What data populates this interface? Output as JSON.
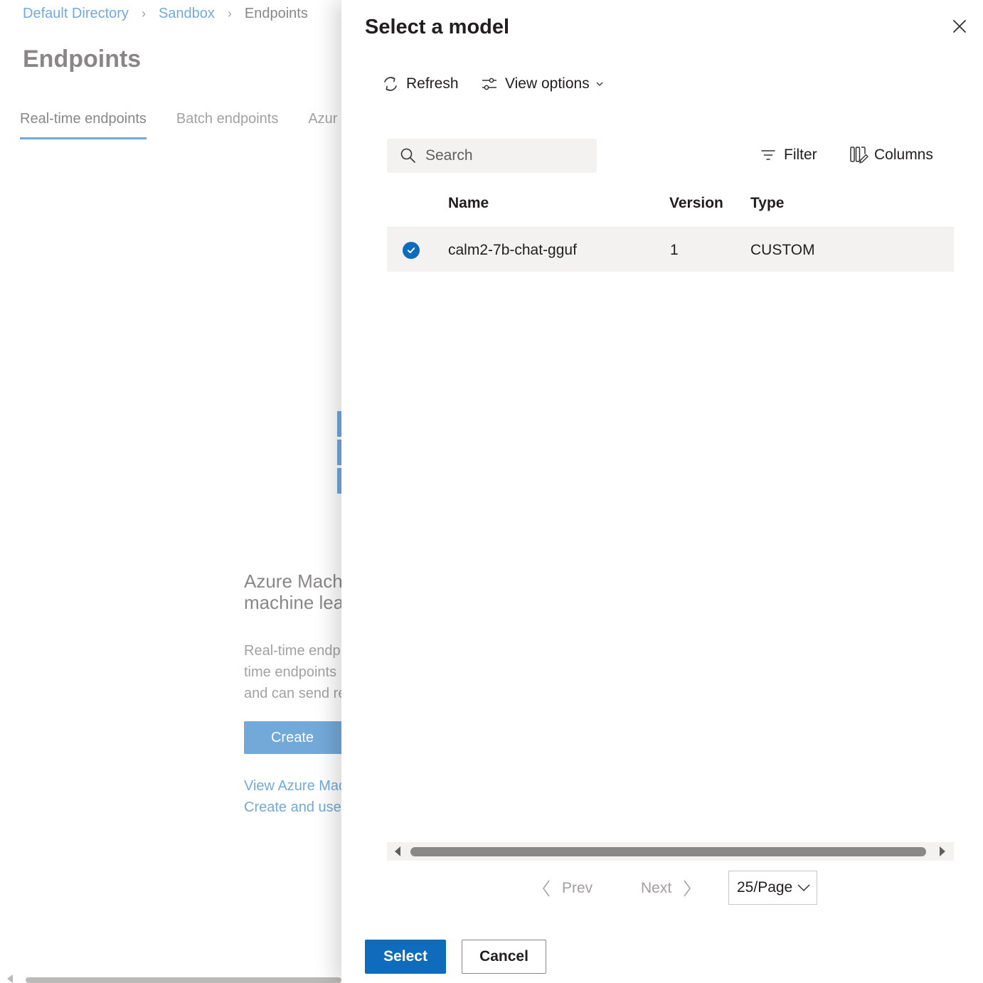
{
  "background": {
    "breadcrumb": [
      {
        "label": "Default Directory"
      },
      {
        "label": "Sandbox"
      },
      {
        "label": "Endpoints"
      }
    ],
    "page_title": "Endpoints",
    "tabs": [
      {
        "label": "Real-time endpoints",
        "active": true
      },
      {
        "label": "Batch endpoints",
        "active": false
      },
      {
        "label": "Azur",
        "active": false
      }
    ],
    "promo": {
      "heading_line1": "Azure Mach",
      "heading_line2": "machine lea",
      "text_line1": "Real-time endp",
      "text_line2": "time endpoints",
      "text_line3": "and can send re",
      "create_label": "Create",
      "link1": "View Azure Mac",
      "link2": "Create and use"
    }
  },
  "panel": {
    "title": "Select a model",
    "commands": {
      "refresh_label": "Refresh",
      "view_options_label": "View options"
    },
    "search": {
      "placeholder": "Search",
      "value": ""
    },
    "toolbar": {
      "filter_label": "Filter",
      "columns_label": "Columns"
    },
    "table": {
      "columns": [
        "Name",
        "Version",
        "Type"
      ],
      "rows": [
        {
          "selected": true,
          "name": "calm2-7b-chat-gguf",
          "version": "1",
          "type": "CUSTOM"
        }
      ]
    },
    "pagination": {
      "prev_label": "Prev",
      "next_label": "Next",
      "page_size": "25/Page"
    },
    "footer": {
      "select_label": "Select",
      "cancel_label": "Cancel"
    }
  },
  "colors": {
    "accent": "#0f6cbd",
    "row_selected_bg": "#f3f2f1",
    "disabled_text": "#a19f9d"
  }
}
